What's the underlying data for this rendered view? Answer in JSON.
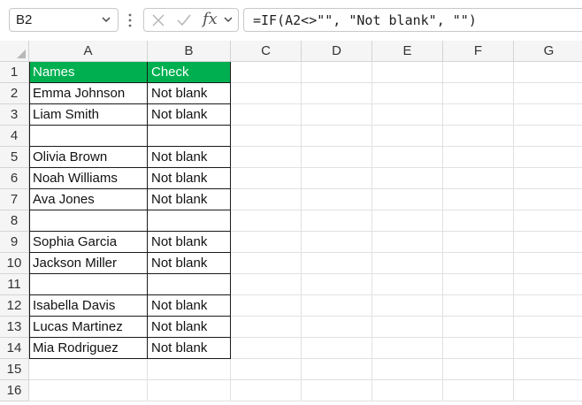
{
  "formula_bar": {
    "name_box": "B2",
    "fx_label": "fx",
    "formula": "=IF(A2<>\"\", \"Not blank\", \"\")"
  },
  "columns": [
    "A",
    "B",
    "C",
    "D",
    "E",
    "F",
    "G"
  ],
  "rows": [
    "1",
    "2",
    "3",
    "4",
    "5",
    "6",
    "7",
    "8",
    "9",
    "10",
    "11",
    "12",
    "13",
    "14",
    "15",
    "16"
  ],
  "table": {
    "header": [
      "Names",
      "Check"
    ],
    "data": [
      [
        "Emma Johnson",
        "Not blank"
      ],
      [
        "Liam Smith",
        "Not blank"
      ],
      [
        "",
        ""
      ],
      [
        "Olivia Brown",
        "Not blank"
      ],
      [
        "Noah Williams",
        "Not blank"
      ],
      [
        "Ava Jones",
        "Not blank"
      ],
      [
        "",
        ""
      ],
      [
        "Sophia Garcia",
        "Not blank"
      ],
      [
        "Jackson Miller",
        "Not blank"
      ],
      [
        "",
        ""
      ],
      [
        "Isabella Davis",
        "Not blank"
      ],
      [
        "Lucas Martinez",
        "Not blank"
      ],
      [
        "Mia Rodriguez",
        "Not blank"
      ]
    ]
  },
  "colors": {
    "header_fill": "#00b050",
    "header_text": "#ffffff"
  },
  "icons": [
    "chevron-down-icon",
    "more-options-icon",
    "cancel-icon",
    "enter-icon",
    "insert-function-icon"
  ]
}
